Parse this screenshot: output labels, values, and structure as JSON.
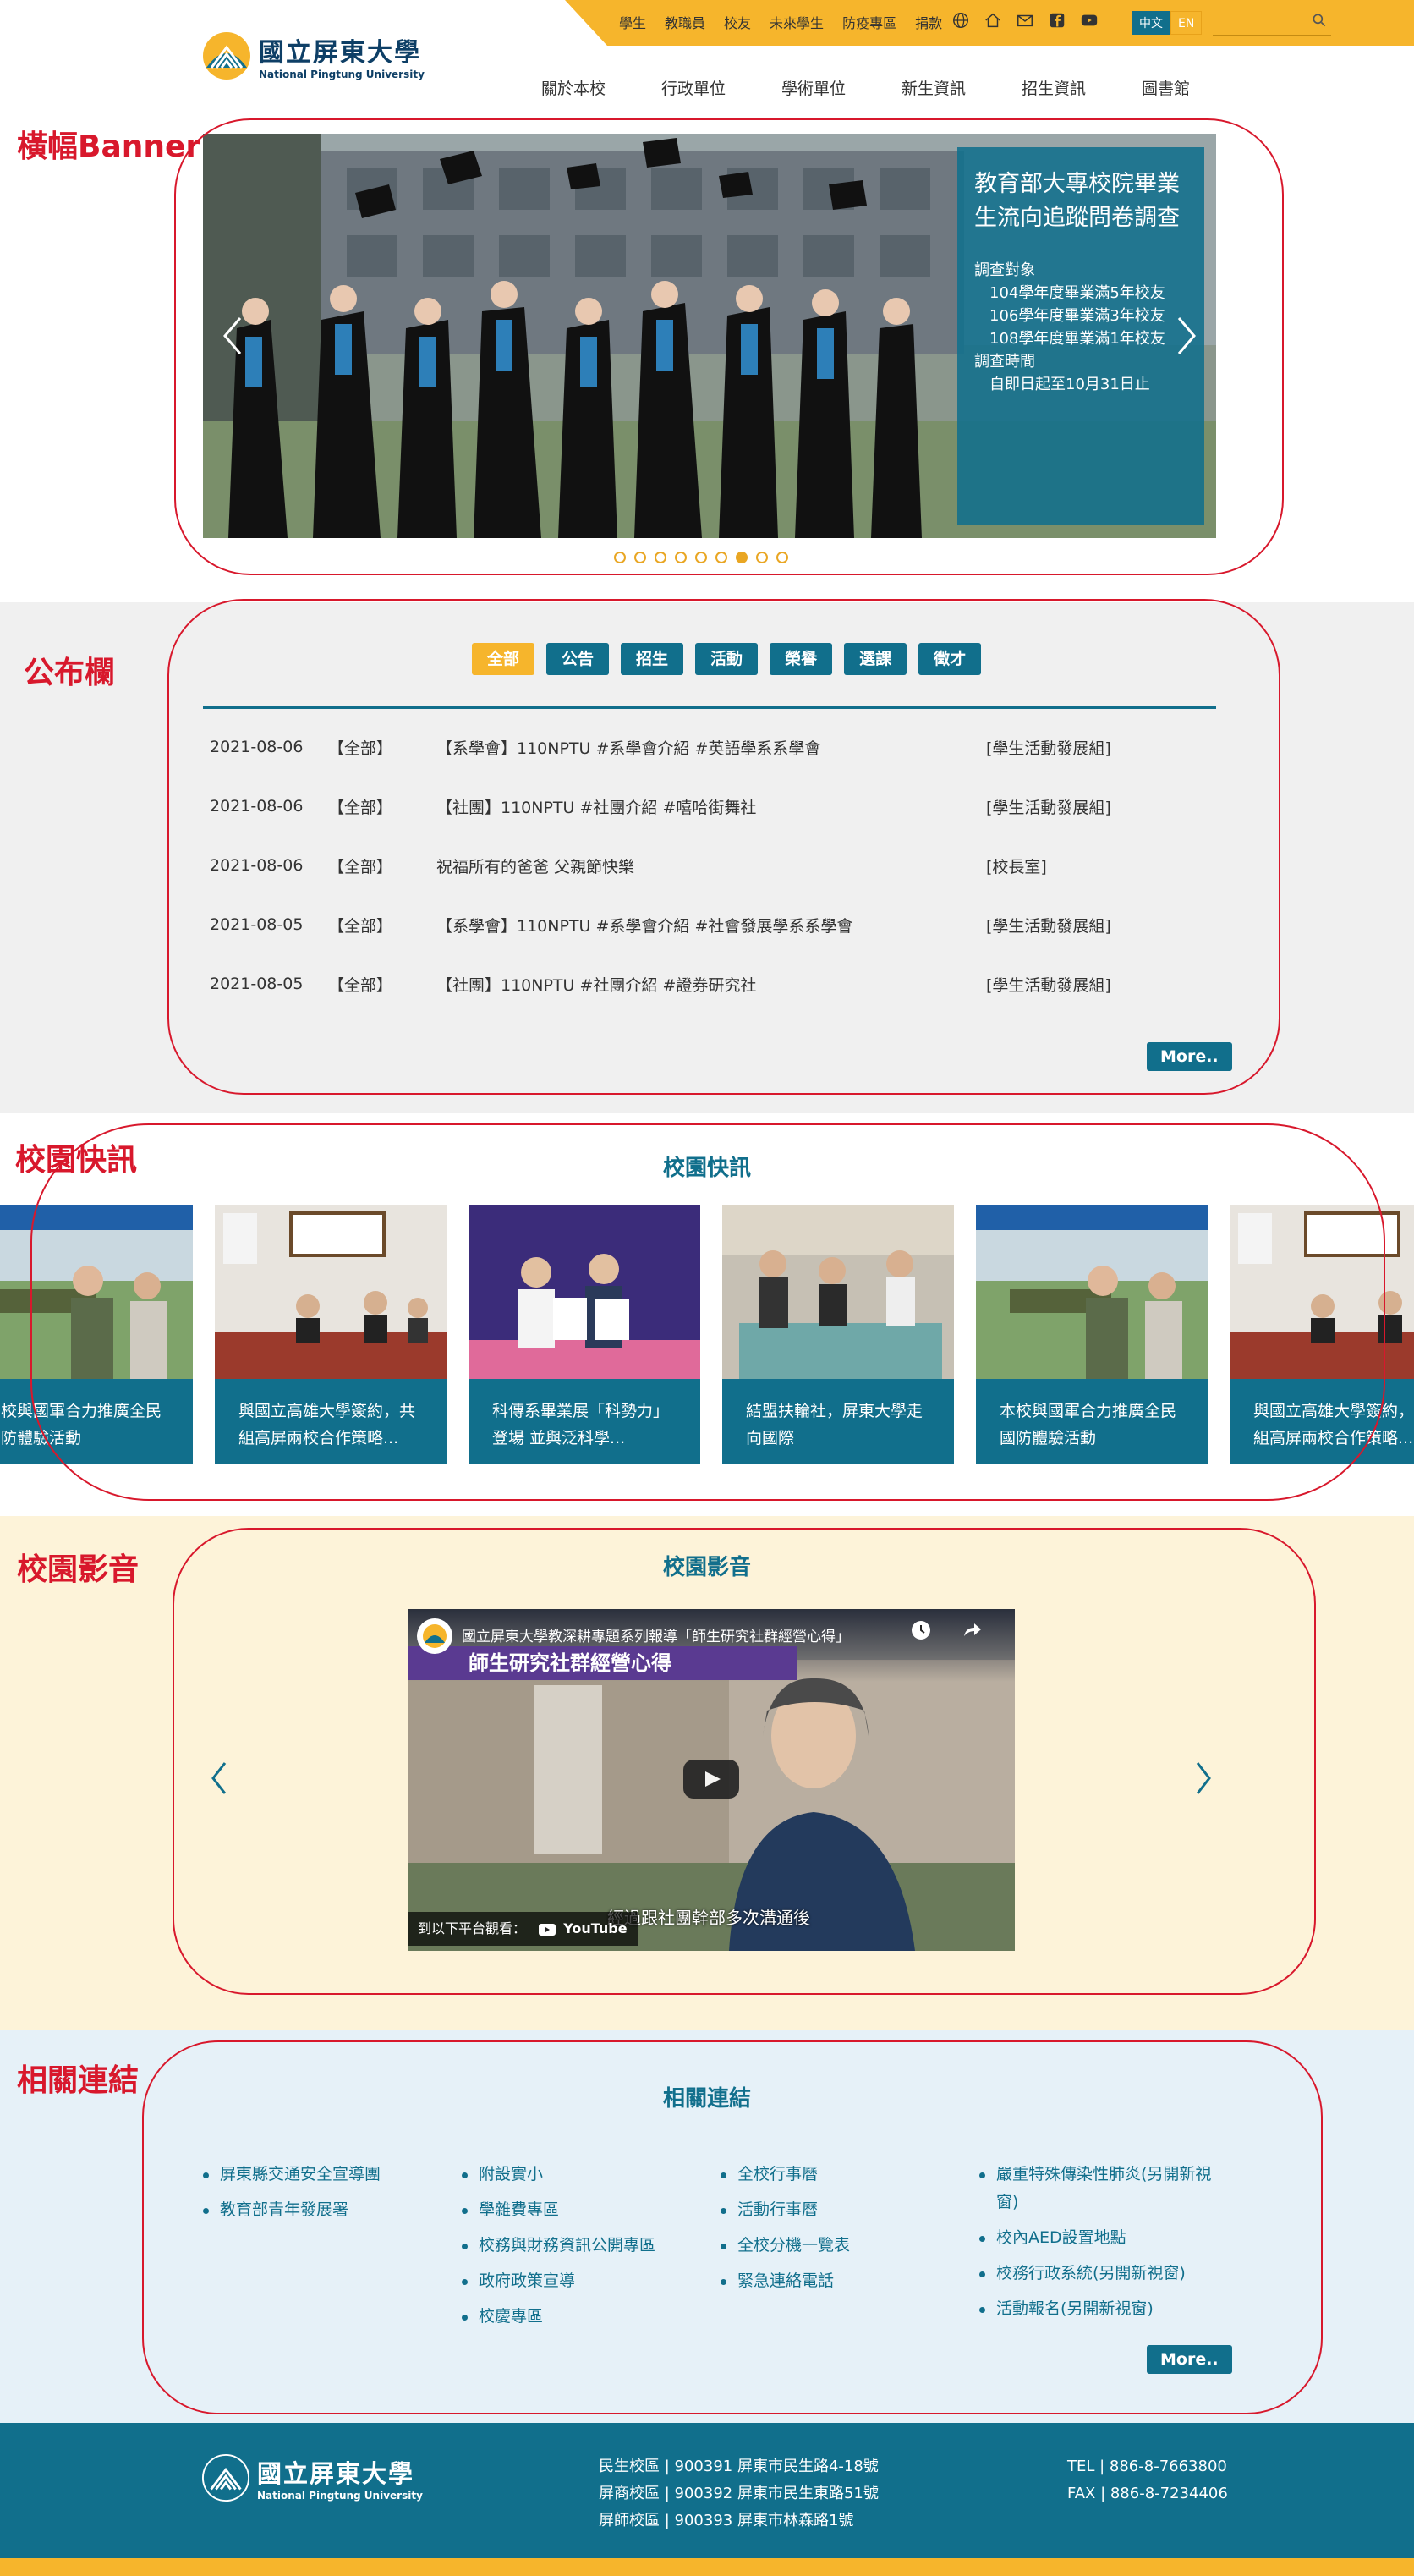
{
  "header": {
    "toplinks": [
      "學生",
      "教職員",
      "校友",
      "未來學生",
      "防疫專區",
      "捐款"
    ],
    "lang_zh": "中文",
    "lang_en": "EN",
    "search_placeholder": "",
    "logo_cn": "國立屏東大學",
    "logo_en": "National Pingtung University",
    "nav": [
      "關於本校",
      "行政單位",
      "學術單位",
      "新生資訊",
      "招生資訊",
      "圖書館"
    ],
    "colors": {
      "brand": "#116f8c",
      "accent": "#f6b52c",
      "annotation": "#d8182c"
    }
  },
  "annotations": {
    "banner": "橫幅Banner",
    "announcements": "公布欄",
    "news": "校園快訊",
    "video": "校園影音",
    "links": "相關連結"
  },
  "banner": {
    "title": "教育部大專校院畢業生流向追蹤問卷調查",
    "lines": [
      "調查對象",
      "104學年度畢業滿5年校友",
      "106學年度畢業滿3年校友",
      "108學年度畢業滿1年校友",
      "調查時間",
      "自即日起至10月31日止"
    ],
    "dots_total": 9,
    "active_dot": 7
  },
  "announcements": {
    "categories": [
      "全部",
      "公告",
      "招生",
      "活動",
      "榮譽",
      "選課",
      "徵才"
    ],
    "active_category": 0,
    "rows": [
      {
        "date": "2021-08-06",
        "cat": "【全部】",
        "title": "【系學會】110NPTU #系學會介紹 #英語學系系學會",
        "unit": "[學生活動發展組]"
      },
      {
        "date": "2021-08-06",
        "cat": "【全部】",
        "title": "【社團】110NPTU #社團介紹 #嘻哈街舞社",
        "unit": "[學生活動發展組]"
      },
      {
        "date": "2021-08-06",
        "cat": "【全部】",
        "title": "祝福所有的爸爸 父親節快樂",
        "unit": "[校長室]"
      },
      {
        "date": "2021-08-05",
        "cat": "【全部】",
        "title": "【系學會】110NPTU #系學會介紹 #社會發展學系系學會",
        "unit": "[學生活動發展組]"
      },
      {
        "date": "2021-08-05",
        "cat": "【全部】",
        "title": "【社團】110NPTU #社團介紹 #證券研究社",
        "unit": "[學生活動發展組]"
      }
    ],
    "more": "More.."
  },
  "news": {
    "title": "校園快訊",
    "cards": [
      "本校與國軍合力推廣全民國防體驗活動",
      "與國立高雄大學簽約，共組高屏兩校合作策略...",
      "科傳系畢業展「科勢力」登場 並與泛科學...",
      "結盟扶輪社，屏東大學走向國際",
      "本校與國軍合力推廣全民國防體驗活動",
      "與國立高雄大學簽約，共組高屏兩校合作策略..."
    ]
  },
  "video": {
    "title": "校園影音",
    "video_title": "國立屏東大學教深耕專題系列報導「師生研究社群經營心得」",
    "banner_text": "師生研究社群經營心得",
    "watch_on": "到以下平台觀看：",
    "youtube": "YouTube",
    "subtitle": "經過跟社團幹部多次溝通後"
  },
  "links": {
    "title": "相關連結",
    "columns": [
      [
        "屏東縣交通安全宣導團",
        "教育部青年發展署"
      ],
      [
        "附設實小",
        "學雜費專區",
        "校務與財務資訊公開專區",
        "政府政策宣導",
        "校慶專區"
      ],
      [
        "全校行事曆",
        "活動行事曆",
        "全校分機一覽表",
        "緊急連絡電話"
      ],
      [
        "嚴重特殊傳染性肺炎(另開新視窗)",
        "校內AED設置地點",
        "校務行政系統(另開新視窗)",
        "活動報名(另開新視窗)"
      ]
    ],
    "more": "More.."
  },
  "footer": {
    "logo_cn": "國立屏東大學",
    "logo_en": "National Pingtung University",
    "addresses": [
      "民生校區 | 900391 屏東市民生路4-18號",
      "屏商校區 | 900392 屏東市民生東路51號",
      "屏師校區 | 900393 屏東市林森路1號"
    ],
    "tel": "TEL | 886-8-7663800",
    "fax": "FAX | 886-8-7234406"
  }
}
